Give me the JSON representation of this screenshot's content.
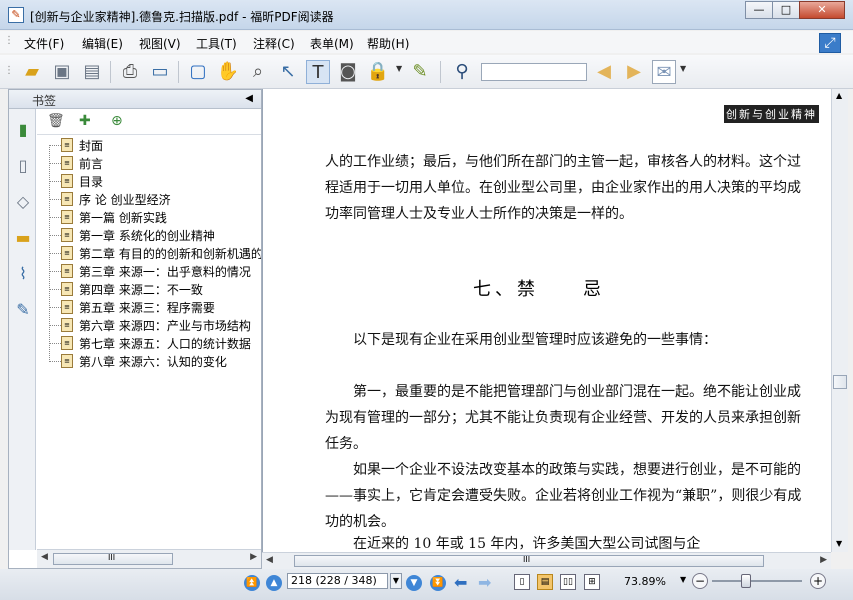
{
  "window": {
    "title": "[创新与企业家精神].德鲁克.扫描版.pdf - 福昕PDF阅读器",
    "minimize": "—",
    "maximize": "□",
    "close": "✕"
  },
  "menu": {
    "items": [
      "文件(F)",
      "编辑(E)",
      "视图(V)",
      "工具(T)",
      "注释(C)",
      "表单(M)",
      "帮助(H)"
    ]
  },
  "toolbar": {
    "find_value": "",
    "icons": [
      "open-icon",
      "save-icon",
      "save-as-icon",
      "print-icon",
      "properties-icon",
      "fullscreen-icon",
      "hand-tool-icon",
      "zoom-tool-icon",
      "select-arrow-icon",
      "text-select-icon",
      "snapshot-icon",
      "rms-lock-icon",
      "sign-pen-icon",
      "binoculars-icon",
      "find-prev-icon",
      "find-next-icon",
      "comment-bubble-icon"
    ]
  },
  "sidebar": {
    "title": "书签",
    "close_glyph": "◀",
    "bookmarks": [
      {
        "label": "封面"
      },
      {
        "label": "前言"
      },
      {
        "label": "目录"
      },
      {
        "label": "序 论 创业型经济"
      },
      {
        "label": "第一篇 创新实践"
      },
      {
        "label": "第一章 系统化的创业精神"
      },
      {
        "label": "第二章 有目的的创新和创新机遇的"
      },
      {
        "label": "第三章 来源一：出乎意料的情况"
      },
      {
        "label": "第四章 来源二：不一致"
      },
      {
        "label": "第五章 来源三：程序需要"
      },
      {
        "label": "第六章 来源四：产业与市场结构"
      },
      {
        "label": "第七章 来源五：人口的统计数据"
      },
      {
        "label": "第八章 来源六：认知的变化"
      }
    ],
    "scroll_label": "III"
  },
  "document": {
    "header_mark": "创新与创业精神",
    "paragraph1": "人的工作业绩；最后，与他们所在部门的主管一起，审核各人的材料。这个过程适用于一切用人单位。在创业型公司里，由企业家作出的用人决策的平均成功率同管理人士及专业人士所作的决策是一样的。",
    "heading": "七、禁　　忌",
    "paragraph2": "　　以下是现有企业在采用创业型管理时应该避免的一些事情：",
    "paragraph3": "　　第一，最重要的是不能把管理部门与创业部门混在一起。绝不能让创业成为现有管理的一部分；尤其不能让负责现有企业经营、开发的人员来承担创新任务。",
    "paragraph4": "　　如果一个企业不设法改变基本的政策与实践，想要进行创业，是不可能的——事实上，它肯定会遭受失败。企业若将创业工作视为“兼职”，则很少有成功的机会。",
    "paragraph5": "　　在近来的 10 年或 15 年内，许多美国大型公司试图与企"
  },
  "status": {
    "page_field": "218 (228 / 348)",
    "zoom": "73.89%",
    "hscroll_label": "III"
  }
}
